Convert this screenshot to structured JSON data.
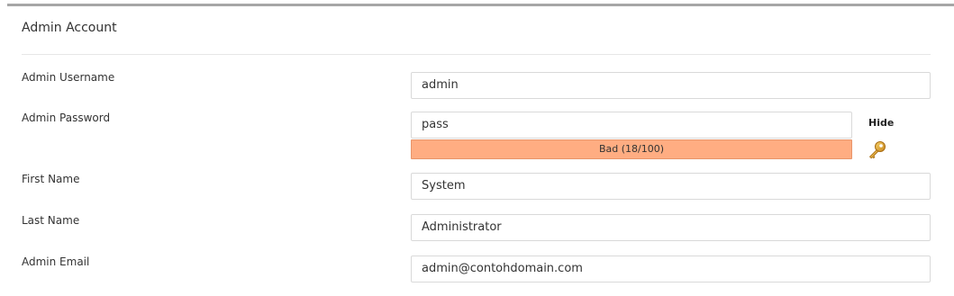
{
  "section": {
    "title": "Admin Account"
  },
  "fields": {
    "username": {
      "label": "Admin Username",
      "value": "admin"
    },
    "password": {
      "label": "Admin Password",
      "value": "pass",
      "strength_text": "Bad (18/100)",
      "strength_score": 18,
      "strength_color": "#ffad82",
      "toggle_label": "Hide",
      "generate_icon": "key-icon"
    },
    "first_name": {
      "label": "First Name",
      "value": "System"
    },
    "last_name": {
      "label": "Last Name",
      "value": "Administrator"
    },
    "email": {
      "label": "Admin Email",
      "value": "admin@contohdomain.com"
    }
  }
}
